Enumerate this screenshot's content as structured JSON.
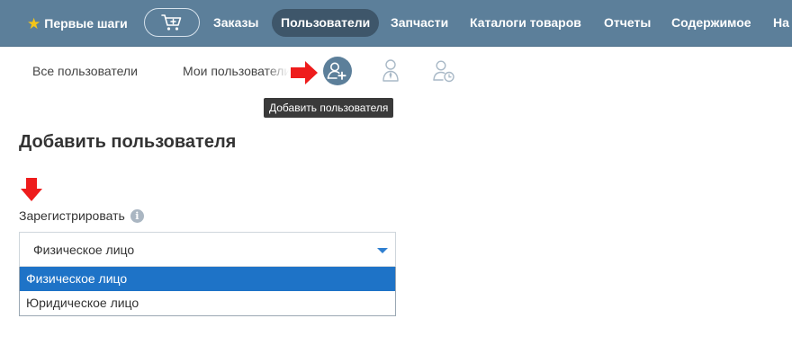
{
  "topnav": {
    "first_steps": "Первые шаги",
    "items": [
      "Заказы",
      "Пользователи",
      "Запчасти",
      "Каталоги товаров",
      "Отчеты",
      "Содержимое",
      "На"
    ],
    "active_index": 1
  },
  "subnav": {
    "tabs": [
      "Все пользователи",
      "Мои пользователи"
    ],
    "tooltip": "Добавить пользователя"
  },
  "form": {
    "title": "Добавить пользователя",
    "register_label": "Зарегистрировать",
    "info_glyph": "i",
    "selected_value": "Физическое лицо",
    "options": [
      "Физическое лицо",
      "Юридическое лицо"
    ],
    "highlighted_option_index": 0
  },
  "colors": {
    "nav_bg": "#5c7f9a",
    "nav_active_bg": "#3e566a",
    "star": "#f5c518",
    "dropdown_highlight": "#1e73c7",
    "annotation_arrow": "#ee1c1c",
    "add_user_icon_bg": "#5c7f9a"
  },
  "icons": [
    "star-icon",
    "cart-icon",
    "add-user-icon",
    "user-tie-icon",
    "user-clock-icon",
    "info-icon",
    "dropdown-caret-icon",
    "red-arrow-right",
    "red-arrow-down"
  ]
}
